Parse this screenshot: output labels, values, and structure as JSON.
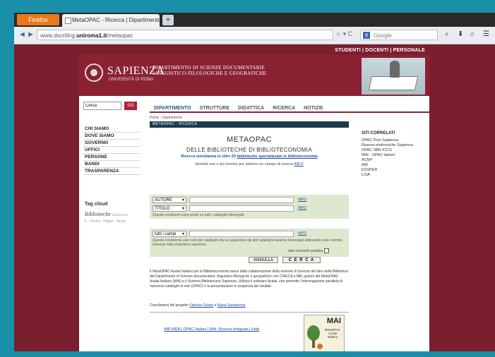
{
  "browser": {
    "app_button": "Firefox",
    "tab_title": "MetaOPAC - Ricerca | Dipartimento di S...",
    "new_tab": "+",
    "url_prefix": "www.dscritlng.",
    "url_domain": "uniroma1.it",
    "url_path": "/metaopac",
    "search_placeholder": "Google",
    "search_engine_glyph": "g",
    "back": "◄",
    "forward": "►",
    "reload_star": "☆ ▾ C",
    "tool_icons": [
      "⌕",
      "⬇",
      "⌂",
      "☰"
    ]
  },
  "site": {
    "top_links": "STUDENTI | DOCENTI | PERSONALE",
    "brand": "SAPIENZA",
    "brand_sub": "UNIVERSITÀ DI ROMA",
    "department": "DIPARTIMENTO DI SCIENZE DOCUMENTARIE LINGUISTICO-FILOLOGICHE E GEOGRAFICHE",
    "search_value": "Cerca",
    "search_button": "GO",
    "menu": [
      "DIPARTIMENTO",
      "STRUTTURE",
      "DIDATTICA",
      "RICERCA",
      "NOTIZIE"
    ],
    "left_nav": [
      "CHI SIAMO",
      "DOVE SIAMO",
      "GOVERNO",
      "UFFICI",
      "PERSONE",
      "BANDI",
      "TRASPARENZA"
    ],
    "tag_title": "Tag cloud",
    "tag_main": "Biblioteche",
    "tag_small": "biblioteche",
    "tag_row": "Il Centro  Hopes  library"
  },
  "content": {
    "breadcrumb": "Home › Dipartimento",
    "section_bar": "METAOPAC · RICERCA",
    "title": "METAOPAC",
    "subtitle": "DELLE BIBLIOTECHE DI BIBLIOTECONOMIA",
    "line3": "Ricerca simultanea in oltre 20",
    "line3_link": "biblioteche specializzate in biblioteconomia",
    "line4": "Immetti uno o più termini per almeno un campo di ricerca",
    "line4_link": "INFO",
    "rows": [
      {
        "select": "AUTORE",
        "info": "INFO"
      },
      {
        "select": "TITOLO",
        "info": "INFO"
      }
    ],
    "panel1_note": "Queste condizioni sono poste su tutti i cataloghi interrogati",
    "row3": {
      "select": "tutti i campi",
      "info": "INFO"
    },
    "panel2_note": "Questa condizione vale solo per cataloghi che la supportano gli altri cataloghi saranno interrogati utilizzando solo i termini immessi nella maschera superiore",
    "checkbox_label": "solo risorse/le positive",
    "btn_reset": "ANNULLA",
    "btn_search": "C E R C A",
    "description": "Il MetaOPAC Azalai Italiano per la Biblioteconomia nasce dalla collaborazione della sezione di Scienze del libro della Biblioteca del Dipartimento di Scienze documentarie, linguistico-filologiche e geografiche con CINECA e MB, gestori del MetaOPAC Azalai Italiano (MAI) e il Sistema Bibliotecario Sapienza. Utilizza il software Azalai, che permette l'interrogazione parallela di numerosi cataloghi in rete (OPAC) e la presentazione in sequenza dei risultati.",
    "coordinators_prefix": "Coordinatori del progetto",
    "coordinator1": "Fabrizio Zuliani",
    "coordinator_sep": "e",
    "coordinator2": "Maria Santamaria",
    "footer_links": "AIB-WEB | OPAC Italiani | MAI: Ricerca Integrata | Help",
    "mai_title": "MAI",
    "mai_sub": "MetaOPAC Azalai Italiano"
  },
  "right": {
    "title": "SITI CORRELATI",
    "links": [
      "OPAC Polo Sapienza",
      "Risorse elettroniche Sapienza",
      "OPAC SBN ICCU",
      "MAI - OPAC italiani",
      "ACNP",
      "AIB",
      "ESSPER",
      "LISA"
    ]
  }
}
